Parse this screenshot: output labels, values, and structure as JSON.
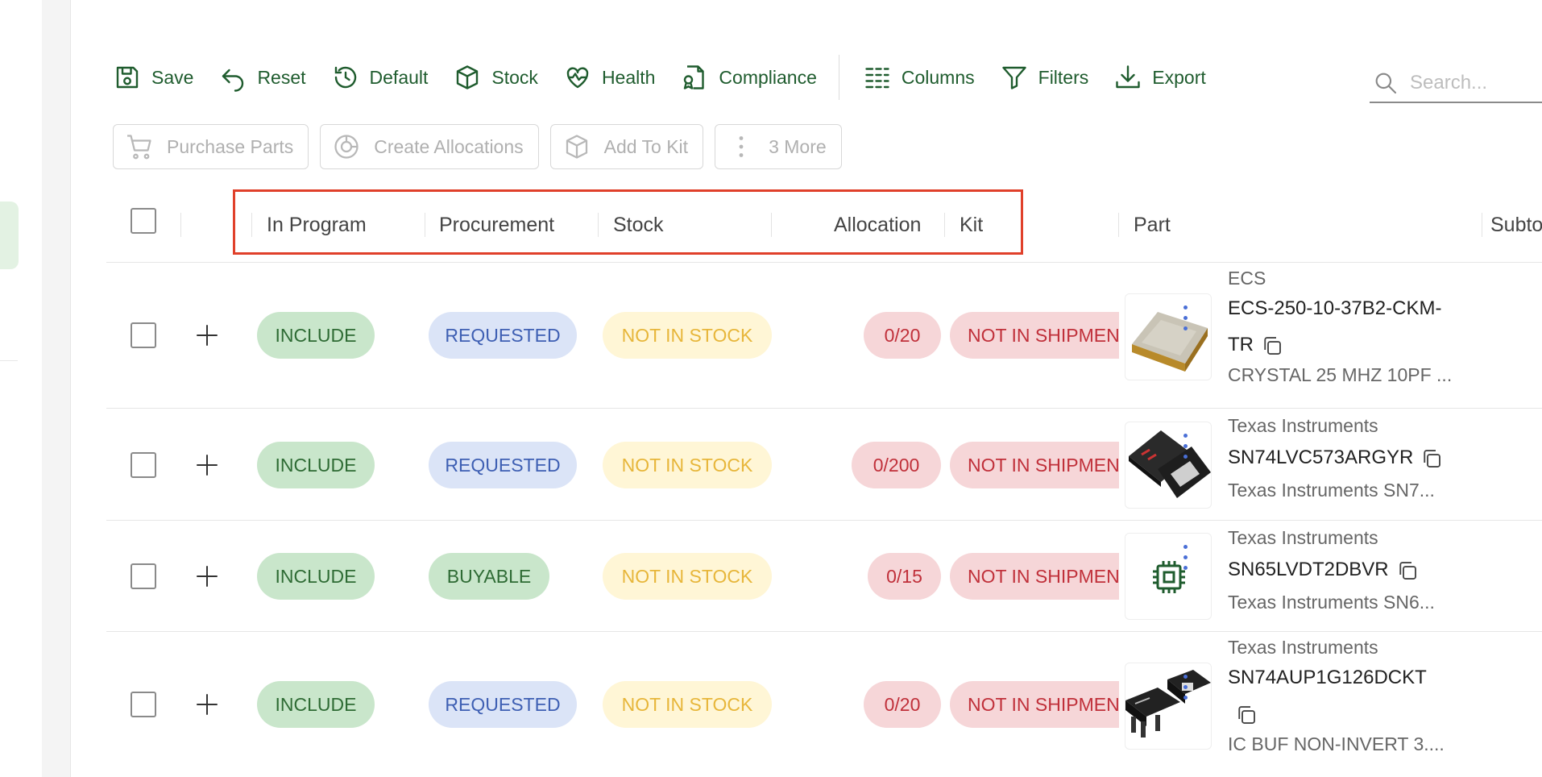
{
  "toolbar": {
    "save": "Save",
    "reset": "Reset",
    "default": "Default",
    "stock": "Stock",
    "health": "Health",
    "compliance": "Compliance",
    "columns": "Columns",
    "filters": "Filters",
    "export": "Export"
  },
  "search": {
    "placeholder": "Search..."
  },
  "actions": {
    "purchase_parts": "Purchase Parts",
    "create_allocations": "Create Allocations",
    "add_to_kit": "Add To Kit",
    "more": "3 More"
  },
  "columns": {
    "in_program": "In Program",
    "procurement": "Procurement",
    "stock": "Stock",
    "allocation": "Allocation",
    "kit": "Kit",
    "part": "Part",
    "subtotal": "Subto"
  },
  "rows": [
    {
      "in_program": "INCLUDE",
      "procurement": "REQUESTED",
      "stock": "NOT IN STOCK",
      "allocation": "0/20",
      "kit": "NOT IN SHIPMENT",
      "manufacturer": "ECS",
      "part_number_line1": "ECS-250-10-37B2-CKM-",
      "part_number_line2": "TR",
      "description": "CRYSTAL 25 MHZ 10PF ..."
    },
    {
      "in_program": "INCLUDE",
      "procurement": "REQUESTED",
      "stock": "NOT IN STOCK",
      "allocation": "0/200",
      "kit": "NOT IN SHIPMENT",
      "manufacturer": "Texas Instruments",
      "part_number": "SN74LVC573ARGYR",
      "description": "Texas Instruments SN7..."
    },
    {
      "in_program": "INCLUDE",
      "procurement": "BUYABLE",
      "stock": "NOT IN STOCK",
      "allocation": "0/15",
      "kit": "NOT IN SHIPMENT",
      "manufacturer": "Texas Instruments",
      "part_number": "SN65LVDT2DBVR",
      "description": "Texas Instruments SN6..."
    },
    {
      "in_program": "INCLUDE",
      "procurement": "REQUESTED",
      "stock": "NOT IN STOCK",
      "allocation": "0/20",
      "kit": "NOT IN SHIPMENT",
      "manufacturer": "Texas Instruments",
      "part_number": "SN74AUP1G126DCKT",
      "description": "IC BUF NON-INVERT 3...."
    }
  ],
  "colors": {
    "toolbar_green": "#1f5c2e",
    "include_bg": "#c9e6cb",
    "requested_bg": "#dbe4f7",
    "stock_bg": "#fff6d6",
    "alloc_bg": "#f6d6d8",
    "highlight": "#e0402a"
  }
}
